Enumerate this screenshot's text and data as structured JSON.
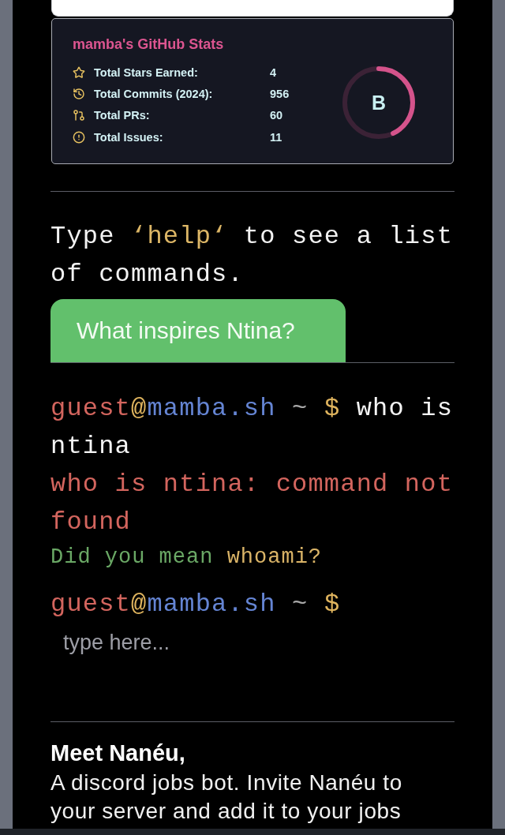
{
  "stats_card": {
    "title": "mamba's GitHub Stats",
    "rows": [
      {
        "kind": "stars",
        "label": "Total Stars Earned:",
        "value": "4"
      },
      {
        "kind": "commits",
        "label": "Total Commits (2024):",
        "value": "956"
      },
      {
        "kind": "prs",
        "label": "Total PRs:",
        "value": "60"
      },
      {
        "kind": "issues",
        "label": "Total Issues:",
        "value": "11"
      }
    ],
    "rank": {
      "grade": "B",
      "level": 0.43
    }
  },
  "hint": [
    {
      "kind": "plain",
      "text": "Type "
    },
    {
      "kind": "command",
      "text": "‘help‘"
    },
    {
      "kind": "plain",
      "text": " to see a list of commands."
    }
  ],
  "prompt_button": {
    "label": "What inspires Ntina?"
  },
  "terminal": {
    "history": [
      {
        "kind": "command",
        "user": "guest",
        "separator": "@",
        "host": "mamba.sh",
        "path": "~",
        "symbol": "$",
        "command": "who is ntina"
      },
      {
        "kind": "error",
        "text": "who is ntina: command not found"
      },
      {
        "kind": "suggestion",
        "text": "Did you mean",
        "suggestion": "whoami?"
      }
    ],
    "prompt": {
      "user": "guest",
      "separator": "@",
      "host": "mamba.sh",
      "path": "~",
      "symbol": "$"
    },
    "input": {
      "placeholder": "type here..."
    }
  },
  "project": {
    "title": "Meet Nanéu,",
    "description": "A discord jobs bot. Invite Nanéu to your server and add it to your jobs"
  }
}
